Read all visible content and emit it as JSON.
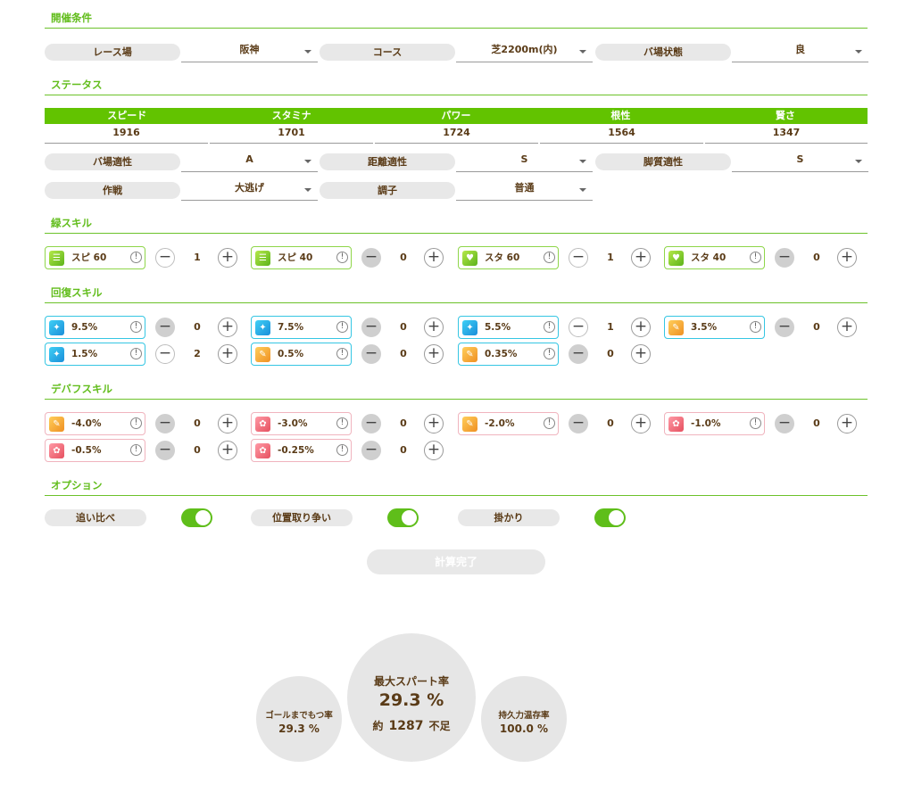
{
  "sections": {
    "conditions": "開催条件",
    "status": "ステータス",
    "green_skills": "緑スキル",
    "recovery_skills": "回復スキル",
    "debuff_skills": "デバフスキル",
    "options": "オプション"
  },
  "conditions": [
    {
      "label": "レース場",
      "value": "阪神"
    },
    {
      "label": "コース",
      "value": "芝2200m(内)"
    },
    {
      "label": "バ場状態",
      "value": "良"
    }
  ],
  "stats": {
    "headers": [
      "スピード",
      "スタミナ",
      "パワー",
      "根性",
      "賢さ"
    ],
    "values": [
      "1916",
      "1701",
      "1724",
      "1564",
      "1347"
    ]
  },
  "aptitudes": [
    {
      "label": "バ場適性",
      "value": "A"
    },
    {
      "label": "距離適性",
      "value": "S"
    },
    {
      "label": "脚質適性",
      "value": "S"
    }
  ],
  "strategy": [
    {
      "label": "作戦",
      "value": "大逃げ"
    },
    {
      "label": "調子",
      "value": "普通"
    }
  ],
  "green_skills": [
    {
      "label": "スピ 60",
      "count": "1",
      "icon": "speed-green-icon",
      "minus_enabled": true
    },
    {
      "label": "スピ 40",
      "count": "0",
      "icon": "speed-green-icon",
      "minus_enabled": false
    },
    {
      "label": "スタ 60",
      "count": "1",
      "icon": "heart-green-icon",
      "minus_enabled": true
    },
    {
      "label": "スタ 40",
      "count": "0",
      "icon": "heart-green-icon",
      "minus_enabled": false
    }
  ],
  "recovery_skills": [
    {
      "label": "9.5%",
      "count": "0",
      "icon": "recovery-blue-icon",
      "minus_enabled": false
    },
    {
      "label": "7.5%",
      "count": "0",
      "icon": "recovery-blue-icon",
      "minus_enabled": false
    },
    {
      "label": "5.5%",
      "count": "1",
      "icon": "recovery-blue-icon",
      "minus_enabled": true
    },
    {
      "label": "3.5%",
      "count": "0",
      "icon": "recovery-orange-icon",
      "minus_enabled": false
    },
    {
      "label": "1.5%",
      "count": "2",
      "icon": "recovery-blue-icon",
      "minus_enabled": true
    },
    {
      "label": "0.5%",
      "count": "0",
      "icon": "recovery-orange-icon",
      "minus_enabled": false
    },
    {
      "label": "0.35%",
      "count": "0",
      "icon": "recovery-orange-icon",
      "minus_enabled": false
    }
  ],
  "debuff_skills": [
    {
      "label": "-4.0%",
      "count": "0",
      "icon": "debuff-orange-icon",
      "minus_enabled": false
    },
    {
      "label": "-3.0%",
      "count": "0",
      "icon": "debuff-red-icon",
      "minus_enabled": false
    },
    {
      "label": "-2.0%",
      "count": "0",
      "icon": "debuff-orange-icon",
      "minus_enabled": false
    },
    {
      "label": "-1.0%",
      "count": "0",
      "icon": "debuff-red-icon",
      "minus_enabled": false
    },
    {
      "label": "-0.5%",
      "count": "0",
      "icon": "debuff-red-icon",
      "minus_enabled": false
    },
    {
      "label": "-0.25%",
      "count": "0",
      "icon": "debuff-red-icon",
      "minus_enabled": false
    }
  ],
  "options": [
    {
      "label": "追い比べ",
      "on": true
    },
    {
      "label": "位置取り争い",
      "on": true
    },
    {
      "label": "掛かり",
      "on": true
    }
  ],
  "calc_button": "計算完了",
  "results": {
    "goal_label": "ゴールまでもつ率",
    "goal_value": "29.3 %",
    "spurt_label": "最大スパート率",
    "spurt_value": "29.3 %",
    "shortage_prefix": "約",
    "shortage_value": "1287",
    "shortage_suffix": "不足",
    "stamina_label": "持久力温存率",
    "stamina_value": "100.0 %"
  },
  "colors": {
    "accent": "#62bd1c",
    "text": "#5a3b17",
    "green_border": "#8fd64a",
    "blue_border": "#35c6e3",
    "pink_border": "#f0b4be"
  }
}
